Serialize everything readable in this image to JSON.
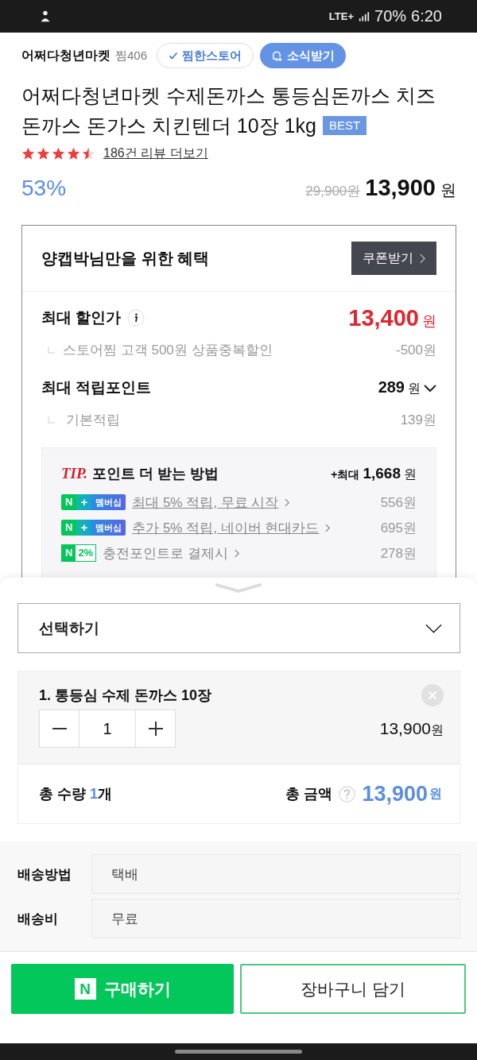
{
  "status_bar": {
    "network": "LTE+",
    "battery": "70%",
    "time": "6:20"
  },
  "store": {
    "name": "어쩌다청년마켓",
    "likes": "찜406",
    "follow_button": {
      "label": "찜한스토어",
      "checked": true
    },
    "notify_button": "소식받기"
  },
  "product": {
    "title_lines": [
      "어쩌다청년마켓 수제돈까스 통등심돈까스 치즈",
      "돈까스 돈가스 치킨텐더 10장 1kg"
    ],
    "badge": "BEST",
    "stars": 4.5,
    "review_link": "186건 리뷰 더보기",
    "discount": "53%",
    "original_price": "29,900원",
    "price": "13,900",
    "unit": "원"
  },
  "benefits": {
    "title": "양캡박님만을 위한 혜택",
    "coupon_button": "쿠폰받기",
    "max_discount": {
      "label": "최대 할인가",
      "amount": "13,400",
      "unit": "원",
      "detail_label": "스토어찜 고객 500원 상품중복할인",
      "detail_amount": "-500원"
    },
    "max_points": {
      "label": "최대 적립포인트",
      "amount": "289",
      "unit": "원",
      "detail_label": "기본적립",
      "detail_amount": "139원"
    },
    "tip": {
      "tag": "TIP.",
      "title": "포인트 더 받는 방법",
      "total_prefix": "+최대",
      "total": "1,668",
      "unit": "원",
      "rows": [
        {
          "kind": "membership",
          "badge_n": "N",
          "badge_plus": "+",
          "badge_label": "멤버십",
          "text": "최대 5% 적립, 무료 시작",
          "amount": "556원"
        },
        {
          "kind": "membership",
          "badge_n": "N",
          "badge_plus": "+",
          "badge_label": "멤버십",
          "text": "추가 5% 적립, 네이버 현대카드",
          "amount": "695원"
        },
        {
          "kind": "charge",
          "badge_n": "N",
          "badge_label": "2%",
          "text": "충전포인트로 결제시",
          "amount": "278원"
        }
      ]
    }
  },
  "option_select": {
    "label": "선택하기"
  },
  "selected_option": {
    "name": "1. 통등심 수제 돈까스 10장",
    "quantity": "1",
    "price": "13,900",
    "unit": "원"
  },
  "totals": {
    "quantity_label": "총 수량",
    "quantity": "1",
    "quantity_unit": "개",
    "amount_label": "총 금액",
    "amount": "13,900",
    "unit": "원"
  },
  "delivery": [
    {
      "label": "배송방법",
      "value": "택배"
    },
    {
      "label": "배송비",
      "value": "무료"
    }
  ],
  "buttons": {
    "buy": {
      "logo": "N",
      "label": "구매하기"
    },
    "cart": "장바구니 담기"
  }
}
